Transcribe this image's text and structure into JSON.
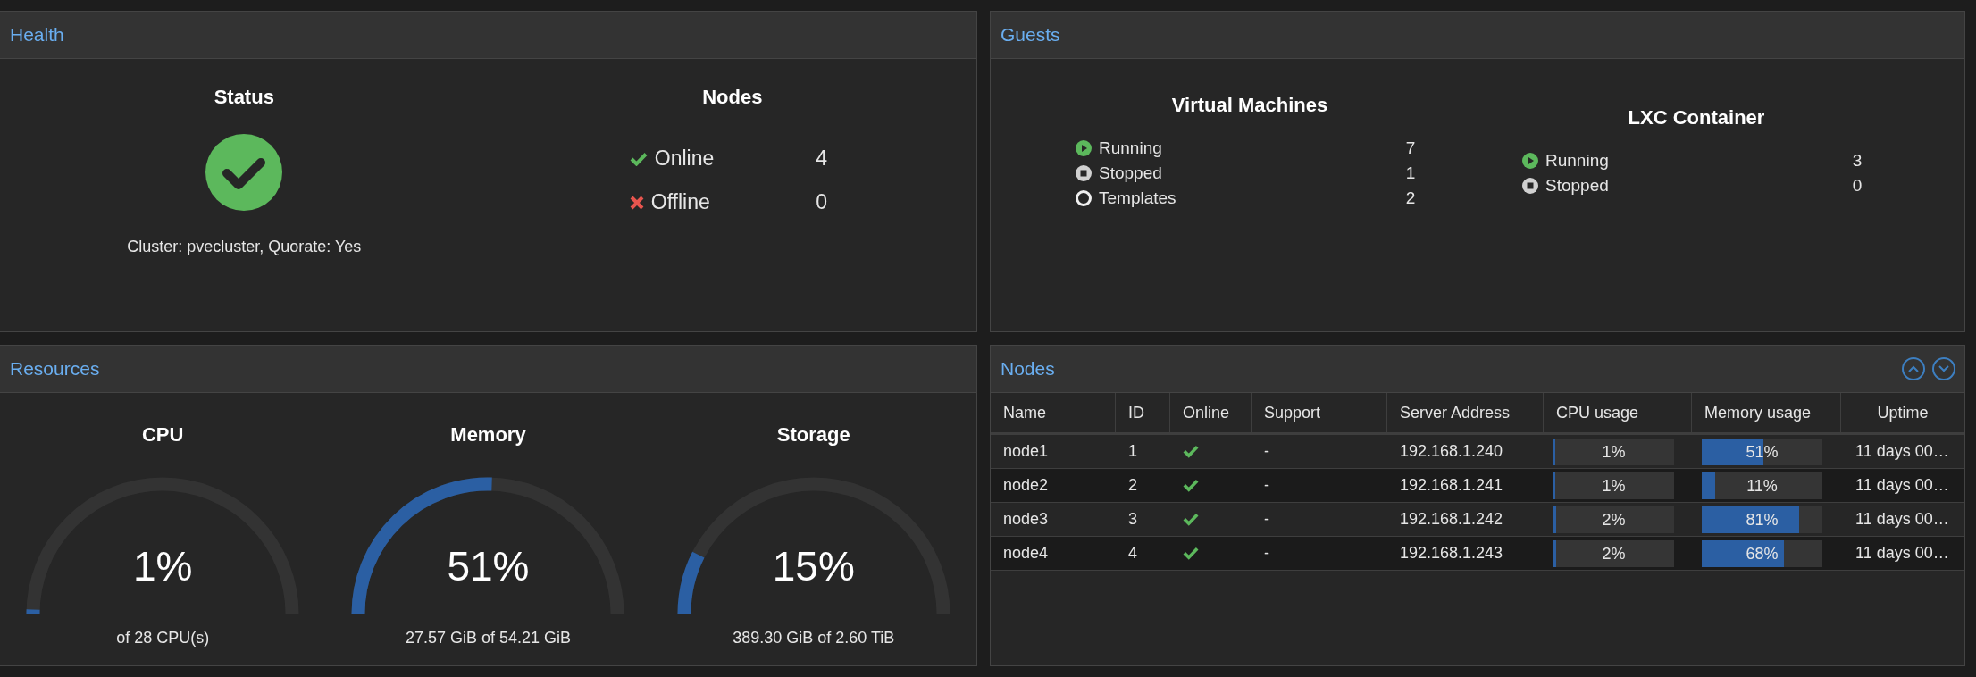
{
  "health": {
    "title": "Health",
    "status": {
      "heading": "Status",
      "kind": "ok",
      "text": "Cluster: pvecluster, Quorate: Yes"
    },
    "nodes": {
      "heading": "Nodes",
      "rows": [
        {
          "kind": "online",
          "label": "Online",
          "count": "4"
        },
        {
          "kind": "offline",
          "label": "Offline",
          "count": "0"
        }
      ]
    }
  },
  "guests": {
    "title": "Guests",
    "groups": [
      {
        "heading": "Virtual Machines",
        "rows": [
          {
            "kind": "running",
            "label": "Running",
            "count": "7"
          },
          {
            "kind": "stopped",
            "label": "Stopped",
            "count": "1"
          },
          {
            "kind": "template",
            "label": "Templates",
            "count": "2"
          }
        ]
      },
      {
        "heading": "LXC Container",
        "rows": [
          {
            "kind": "running",
            "label": "Running",
            "count": "3"
          },
          {
            "kind": "stopped",
            "label": "Stopped",
            "count": "0"
          }
        ]
      }
    ]
  },
  "resources": {
    "title": "Resources",
    "gauges": [
      {
        "heading": "CPU",
        "reading": "1%",
        "detail": "of 28 CPU(s)"
      },
      {
        "heading": "Memory",
        "reading": "51%",
        "detail": "27.57 GiB of 54.21 GiB"
      },
      {
        "heading": "Storage",
        "reading": "15%",
        "detail": "389.30 GiB of 2.60 TiB"
      }
    ]
  },
  "nodes": {
    "title": "Nodes",
    "columns": [
      "Name",
      "ID",
      "Online",
      "Support",
      "Server Address",
      "CPU usage",
      "Memory usage",
      "Uptime"
    ],
    "rows": [
      {
        "name": "node1",
        "id": "1",
        "online": true,
        "support": "-",
        "address": "192.168.1.240",
        "cpu": {
          "level": 0.01,
          "reading": "1%"
        },
        "memory": {
          "level": 0.51,
          "reading": "51%"
        },
        "uptime": "11 days 00…"
      },
      {
        "name": "node2",
        "id": "2",
        "online": true,
        "support": "-",
        "address": "192.168.1.241",
        "cpu": {
          "level": 0.01,
          "reading": "1%"
        },
        "memory": {
          "level": 0.11,
          "reading": "11%"
        },
        "uptime": "11 days 00…"
      },
      {
        "name": "node3",
        "id": "3",
        "online": true,
        "support": "-",
        "address": "192.168.1.242",
        "cpu": {
          "level": 0.02,
          "reading": "2%"
        },
        "memory": {
          "level": 0.81,
          "reading": "81%"
        },
        "uptime": "11 days 00…"
      },
      {
        "name": "node4",
        "id": "4",
        "online": true,
        "support": "-",
        "address": "192.168.1.243",
        "cpu": {
          "level": 0.02,
          "reading": "2%"
        },
        "memory": {
          "level": 0.68,
          "reading": "68%"
        },
        "uptime": "11 days 00…"
      }
    ]
  }
}
